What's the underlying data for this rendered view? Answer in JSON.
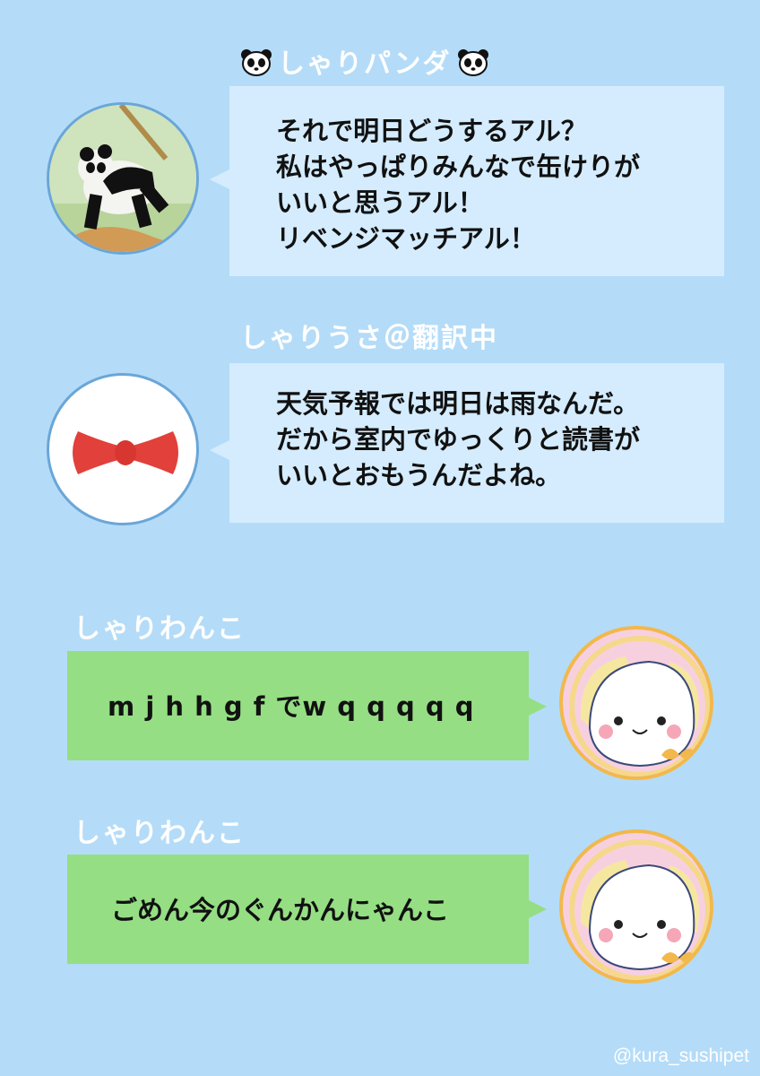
{
  "messages": [
    {
      "sender": "しゃりパンダ",
      "side": "left",
      "avatar": "panda-avatar",
      "text": "それで明日どうするアル？\n私はやっぱりみんなで缶けりが\nいいと思うアル！\nリベンジマッチアル！"
    },
    {
      "sender": "しゃりうさ＠翻訳中",
      "side": "left",
      "avatar": "red-bow-avatar",
      "text": "天気予報では明日は雨なんだ。\nだから室内でゆっくりと読書が\nいいとおもうんだよね。"
    },
    {
      "sender": "しゃりわんこ",
      "side": "right",
      "avatar": "dog-avatar",
      "text": "m j h h g f でw q q q q q"
    },
    {
      "sender": "しゃりわんこ",
      "side": "right",
      "avatar": "dog-avatar",
      "text": "ごめん今のぐんかんにゃんこ"
    }
  ],
  "watermark": "@kura_sushipet",
  "colors": {
    "background": "#b4dcf8",
    "left_bubble": "#d4ecfd",
    "right_bubble": "#95de84",
    "name_text": "#ffffff",
    "message_text": "#111111"
  }
}
